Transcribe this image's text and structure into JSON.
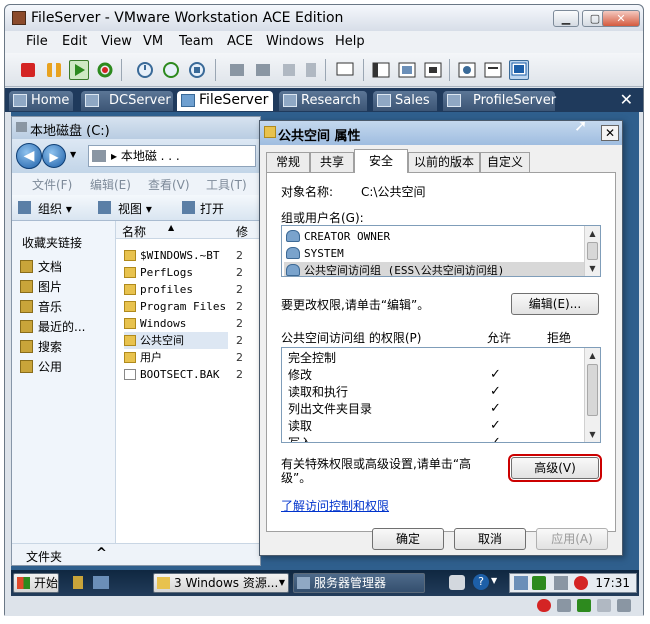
{
  "window": {
    "title": "FileServer - VMware Workstation ACE Edition",
    "minimize_icon": "minimize-icon",
    "maximize_icon": "maximize-icon",
    "close_icon": "close-icon"
  },
  "menu": [
    "File",
    "Edit",
    "View",
    "VM",
    "Team",
    "ACE",
    "Windows",
    "Help"
  ],
  "toolbar_icons": [
    "power-off-icon",
    "suspend-icon",
    "power-on-icon",
    "reset-icon",
    "snapshot-icon",
    "revert-icon",
    "snapshot-manager-icon",
    "network-icon",
    "usb-icon",
    "removable-icon",
    "console-icon",
    "view-icon",
    "fullscreen-icon",
    "unity-icon",
    "quick-switch-icon",
    "summary-icon",
    "console-view-icon"
  ],
  "vm_tabs": [
    {
      "label": "Home",
      "active": false
    },
    {
      "label": "DCServer",
      "active": false
    },
    {
      "label": "FileServer",
      "active": true
    },
    {
      "label": "Research",
      "active": false
    },
    {
      "label": "Sales",
      "active": false
    },
    {
      "label": "ProfileServer",
      "active": false
    }
  ],
  "tabs_close": "✕",
  "explorer": {
    "title": "本地磁盘 (C:)",
    "address": "▸ 本地磁 . . .",
    "menu": [
      "文件(F)",
      "编辑(E)",
      "查看(V)",
      "工具(T)"
    ],
    "commands": [
      "组织 ▾",
      "视图 ▾",
      "打开"
    ],
    "favorites_header": "收藏夹链接",
    "favorites": [
      "文档",
      "图片",
      "音乐",
      "最近的...",
      "搜索",
      "公用"
    ],
    "column_name": "名称",
    "column_date": "修",
    "files": [
      {
        "name": "$WINDOWS.~BT",
        "date": "2"
      },
      {
        "name": "PerfLogs",
        "date": "2"
      },
      {
        "name": "profiles",
        "date": "2"
      },
      {
        "name": "Program Files",
        "date": "2"
      },
      {
        "name": "Windows",
        "date": "2"
      },
      {
        "name": "公共空间",
        "date": "2"
      },
      {
        "name": "用户",
        "date": "2"
      },
      {
        "name": "BOOTSECT.BAK",
        "date": "2"
      }
    ],
    "folders_label": "文件夹"
  },
  "dialog": {
    "title": "公共空间 属性",
    "help": "?",
    "close": "✕",
    "tabs": [
      {
        "label": "常规",
        "active": false
      },
      {
        "label": "共享",
        "active": false
      },
      {
        "label": "安全",
        "active": true
      },
      {
        "label": "以前的版本",
        "active": false
      },
      {
        "label": "自定义",
        "active": false
      }
    ],
    "object_label": "对象名称:",
    "object_value": "C:\\公共空间",
    "groups_label": "组或用户名(G):",
    "groups": [
      "CREATOR OWNER",
      "SYSTEM",
      "公共空间访问组 (ESS\\公共空间访问组)"
    ],
    "change_hint": "要更改权限,请单击“编辑”。",
    "edit_button": "编辑(E)...",
    "perm_header": "公共空间访问组 的权限(P)",
    "allow_header": "允许",
    "deny_header": "拒绝",
    "permissions": [
      {
        "name": "完全控制",
        "allow": ""
      },
      {
        "name": "修改",
        "allow": "✓"
      },
      {
        "name": "读取和执行",
        "allow": "✓"
      },
      {
        "name": "列出文件夹目录",
        "allow": "✓"
      },
      {
        "name": "读取",
        "allow": "✓"
      },
      {
        "name": "写入",
        "allow": "✓"
      }
    ],
    "advanced_hint_1": "有关特殊权限或高级设置,请单击“高",
    "advanced_hint_2": "级”。",
    "advanced_button": "高级(V)",
    "learn_link": "了解访问控制和权限",
    "ok": "确定",
    "cancel": "取消",
    "apply": "应用(A)"
  },
  "taskbar": {
    "start": "开始",
    "task1": "3 Windows 资源...",
    "task2": "服务器管理器",
    "clock": "17:31"
  }
}
